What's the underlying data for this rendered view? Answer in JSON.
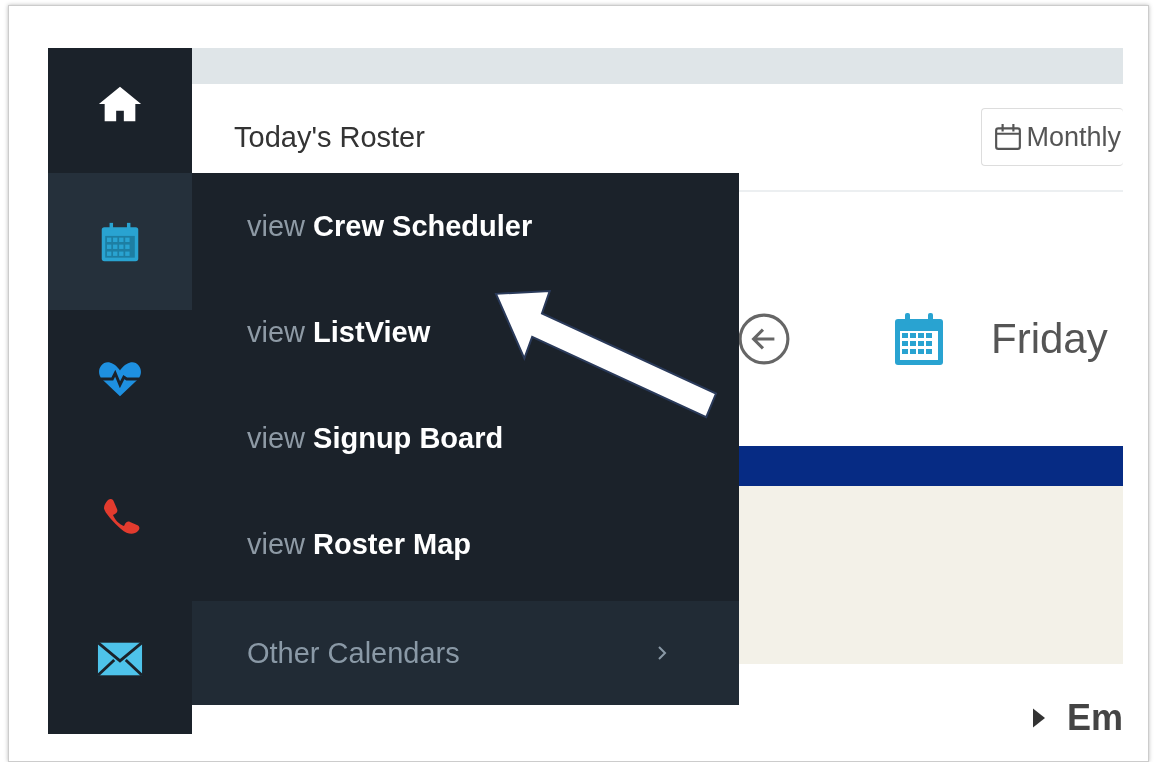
{
  "sidebar": {
    "items": [
      {
        "kind": "home",
        "selected": false
      },
      {
        "kind": "calendar",
        "selected": true
      },
      {
        "kind": "heart",
        "selected": false
      },
      {
        "kind": "phone",
        "selected": false
      },
      {
        "kind": "mail",
        "selected": false
      }
    ]
  },
  "header": {
    "title": "Today's Roster",
    "view_button": "Monthly"
  },
  "menu": {
    "items": [
      {
        "text": "view **Crew Scheduler**"
      },
      {
        "text": "view **ListView**"
      },
      {
        "text": "view **Signup Board**"
      },
      {
        "text": "view **Roster Map**"
      }
    ],
    "submenu": {
      "label": "Other Calendars"
    }
  },
  "date_nav": {
    "date": "Friday"
  },
  "section": {
    "label": "Em"
  },
  "annotation": {
    "kind": "arrow"
  }
}
